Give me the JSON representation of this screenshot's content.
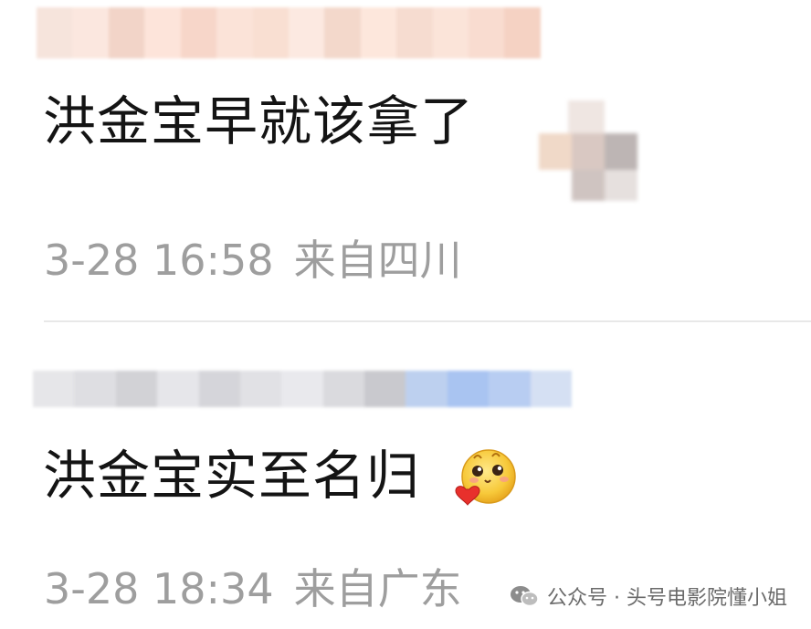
{
  "comments": [
    {
      "text": "洪金宝早就该拿了",
      "time": "3-28 16:58",
      "location": "来自四川",
      "name_blur_colors": [
        "#f6e4dc",
        "#fbe7df",
        "#f2d4c8",
        "#fde4da",
        "#f7d6c9",
        "#fbe3d8",
        "#f9dfd2",
        "#fce9e1",
        "#f3d8cb",
        "#fde7dc",
        "#f6dcd0",
        "#fbe4d9",
        "#f9dcd0",
        "#f5d2c3"
      ],
      "avatar_blur_colors": [
        "#e9e1dc",
        "#d9c9c1",
        "#f0dccf",
        "#c4bcbb",
        "#e8d8cc",
        "#d3c8c3"
      ]
    },
    {
      "text": "洪金宝实至名归",
      "time": "3-28 18:34",
      "location": "来自广东",
      "name_blur_colors": [
        "#e6e6e9",
        "#dedee2",
        "#d2d2d6",
        "#e6e6ea",
        "#d5d5da",
        "#e1e1e5",
        "#e9e9ed",
        "#dadade",
        "#c9c9ce",
        "#bdd0ef",
        "#a9c4f1",
        "#b8cdf2",
        "#d5e0f3"
      ]
    }
  ],
  "watermark": {
    "text": "公众号 · 头号电影院懂小姐",
    "icon": "wechat-official-account-icon"
  }
}
